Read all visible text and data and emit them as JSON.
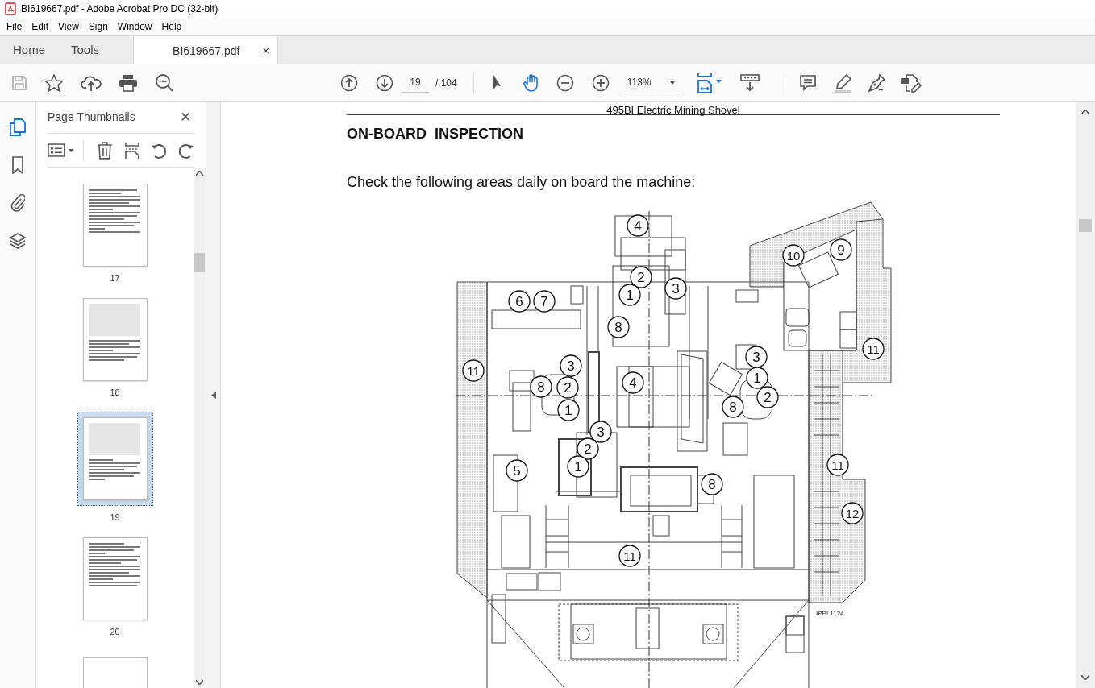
{
  "window": {
    "title": "BI619667.pdf - Adobe Acrobat Pro DC (32-bit)"
  },
  "menu": [
    "File",
    "Edit",
    "View",
    "Sign",
    "Window",
    "Help"
  ],
  "tabs": [
    {
      "label": "Home",
      "selected": false
    },
    {
      "label": "Tools",
      "selected": false
    },
    {
      "label": "BI619667.pdf",
      "selected": true,
      "close": "×"
    }
  ],
  "toolbar": {
    "page": "19",
    "page_total": "/ 104",
    "zoom": "113%"
  },
  "sidebar": {
    "title": "Page Thumbnails",
    "close": "✕",
    "thumbnails": [
      {
        "label": "17",
        "selected": false
      },
      {
        "label": "18",
        "selected": false
      },
      {
        "label": "19",
        "selected": true
      },
      {
        "label": "20",
        "selected": false
      }
    ]
  },
  "document": {
    "header": "495BI Electric Mining Shovel",
    "heading": "ON-BOARD  INSPECTION",
    "intro": "Check the following areas daily on board the machine:",
    "callouts": [
      "4",
      "2",
      "1",
      "3",
      "6",
      "7",
      "8",
      "10",
      "9",
      "11",
      "3",
      "8",
      "2",
      "1",
      "4",
      "3",
      "1",
      "2",
      "8",
      "11",
      "3",
      "2",
      "1",
      "5",
      "8",
      "11",
      "12",
      "11"
    ],
    "figure_code": "IPPL1124"
  }
}
